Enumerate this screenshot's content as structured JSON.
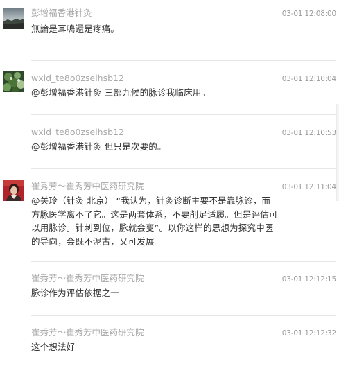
{
  "comments": [
    {
      "username": "彭增福香港针灸",
      "timestamp": "03-01 12:08:00",
      "lines": [
        "無論是耳鳴還是疼痛。"
      ],
      "avatar": "landscape-avatar"
    },
    {
      "username": "wxid_te8o0zseihsb12",
      "timestamp": "03-01 12:10:04",
      "lines": [
        "@彭增福香港针灸 三部九候的脉诊我临床用。"
      ],
      "avatar": "plant-avatar"
    },
    {
      "username": "wxid_te8o0zseihsb12",
      "timestamp": "03-01 12:10:53",
      "lines": [
        "@彭增福香港针灸 但只是次要的。"
      ]
    },
    {
      "username": "崔秀芳～崔秀芳中医药研究院",
      "timestamp": "03-01 12:11:04",
      "lines": [
        "@关玲（针灸 北京）  “我认为，针灸诊断主要不是靠脉诊，而",
        "方脉医学离不了它。这是两套体系，不要削足适履。但是评估可",
        "以用脉诊。针刺到位，脉就会变”。以你这样的思想为探究中医",
        "的导向，会既不泥古，又可发展。"
      ],
      "avatar": "person-avatar"
    },
    {
      "username": "崔秀芳～崔秀芳中医药研究院",
      "timestamp": "03-01 12:12:15",
      "lines": [
        "脉诊作为评估依据之一"
      ]
    },
    {
      "username": "崔秀芳～崔秀芳中医药研究院",
      "timestamp": "03-01 12:12:32",
      "lines": [
        "这个想法好"
      ]
    }
  ],
  "colors": {
    "username": "#a7a7a7",
    "timestamp": "#9a9a9a",
    "body_text": "#333333",
    "separator": "#e6e6e6"
  }
}
